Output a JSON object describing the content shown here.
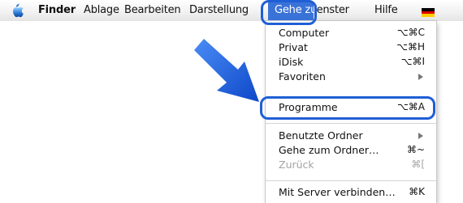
{
  "menubar": {
    "items": [
      {
        "label": "Finder",
        "bold": true
      },
      {
        "label": "Ablage"
      },
      {
        "label": "Bearbeiten"
      },
      {
        "label": "Darstellung"
      },
      {
        "label": "Gehe zu",
        "active": true
      },
      {
        "label": "Fenster"
      },
      {
        "label": "Hilfe"
      }
    ],
    "apple_icon": "apple-logo-icon",
    "flag_icon": "german-flag-icon"
  },
  "menu": {
    "items": [
      {
        "label": "Computer",
        "shortcut": "⌥⌘C"
      },
      {
        "label": "Privat",
        "shortcut": "⌥⌘H"
      },
      {
        "label": "iDisk",
        "shortcut": "⌥⌘I"
      },
      {
        "label": "Favoriten",
        "submenu": true
      },
      {
        "label": "Programme",
        "shortcut": "⌥⌘A",
        "highlighted": true
      },
      {
        "label": "Benutzte Ordner",
        "submenu": true
      },
      {
        "label": "Gehe zum Ordner…",
        "shortcut": "⌘~"
      },
      {
        "label": "Zurück",
        "shortcut": "⌘[",
        "disabled": true
      },
      {
        "label": "Mit Server verbinden…",
        "shortcut": "⌘K"
      }
    ]
  },
  "annotation": {
    "arrow_color": "#1a5fe0",
    "box_color": "#1f5fd6",
    "arrow_icon": "pointer-arrow-icon"
  }
}
